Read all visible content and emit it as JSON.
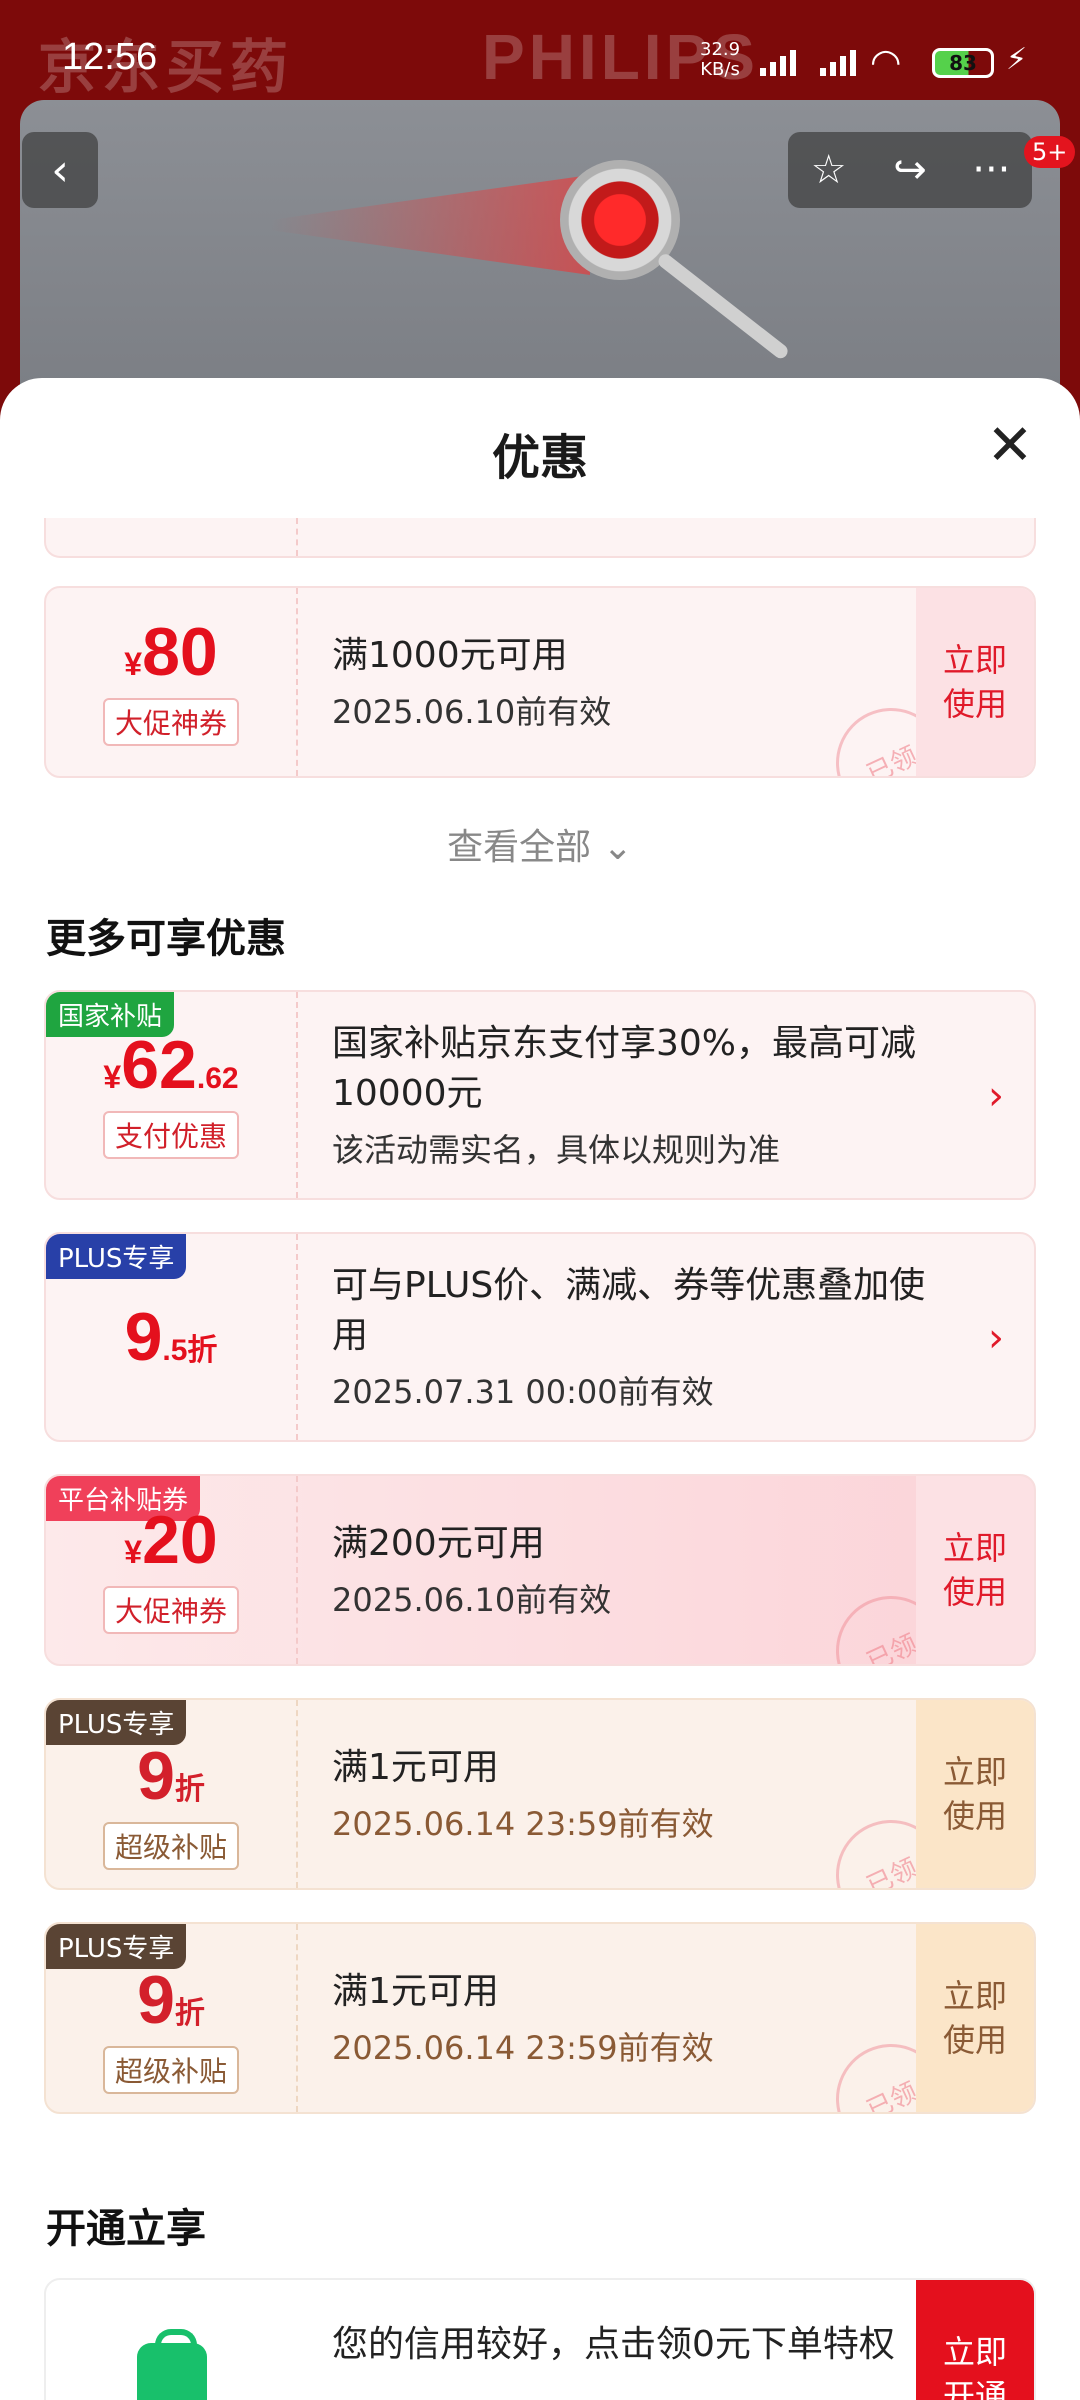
{
  "status_bar": {
    "time": "12:56",
    "net_speed": "32.9",
    "net_unit": "KB/s",
    "battery": "83"
  },
  "background": {
    "brand_left": "京东买药",
    "brand_right": "PHILIPS"
  },
  "nav": {
    "badge": "5+"
  },
  "sheet": {
    "title": "优惠"
  },
  "coupons_top": [
    {
      "currency": "¥",
      "amount": "80",
      "tag": "大促神券",
      "condition": "满1000元可用",
      "validity": "2025.06.10前有效",
      "action": "立即\n使用",
      "stamp": "已领"
    }
  ],
  "view_all": "查看全部",
  "more_section_title": "更多可享优惠",
  "more_offers": [
    {
      "corner": "国家补贴",
      "currency": "¥",
      "amount": "62",
      "decimal": ".62",
      "tag": "支付优惠",
      "line1": "国家补贴京东支付享30%，最高可减10000元",
      "line2": "该活动需实名，具体以规则为准"
    },
    {
      "corner": "PLUS专享",
      "amount": "9",
      "decimal": ".5折",
      "line1": "可与PLUS价、满减、券等优惠叠加使用",
      "line2": "2025.07.31 00:00前有效"
    },
    {
      "corner": "平台补贴券",
      "currency": "¥",
      "amount": "20",
      "tag": "大促神券",
      "line1": "满200元可用",
      "line2": "2025.06.10前有效",
      "action": "立即\n使用",
      "stamp": "已领"
    },
    {
      "corner": "PLUS专享",
      "amount": "9",
      "decimal": "折",
      "tag": "超级补贴",
      "line1": "满1元可用",
      "line2": "2025.06.14 23:59前有效",
      "action": "立即\n使用",
      "stamp": "已领"
    },
    {
      "corner": "PLUS专享",
      "amount": "9",
      "decimal": "折",
      "tag": "超级补贴",
      "line1": "满1元可用",
      "line2": "2025.06.14 23:59前有效",
      "action": "立即\n使用",
      "stamp": "已领"
    }
  ],
  "open_section_title": "开通立享",
  "open_offer": {
    "line1": "您的信用较好，点击领0元下单特权",
    "action": "立即\n开通"
  },
  "colors": {
    "brand_red": "#e4101d",
    "gold_text": "#8a5a35"
  },
  "icons": [
    "back-arrow-icon",
    "star-icon",
    "share-icon",
    "more-icon",
    "close-icon",
    "chevron-down-icon",
    "chevron-right-icon",
    "shopping-bag-icon"
  ]
}
